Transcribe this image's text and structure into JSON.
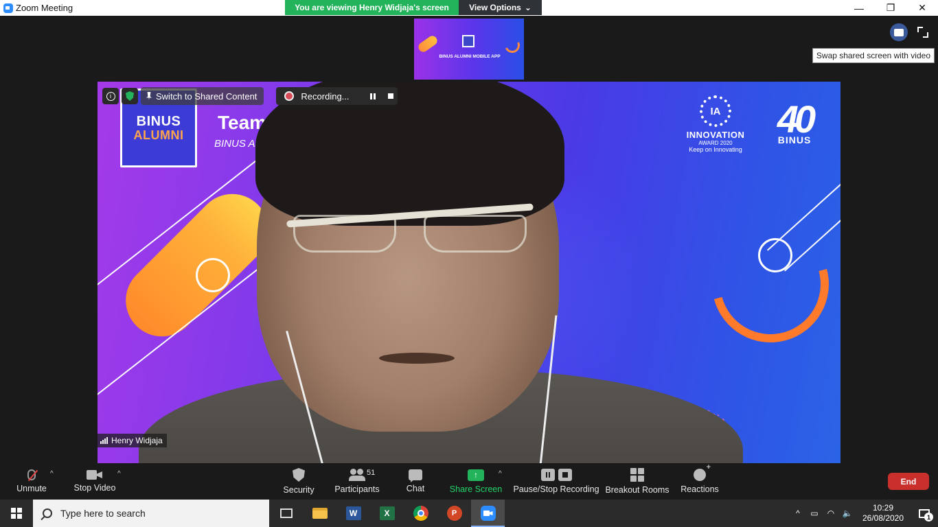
{
  "window": {
    "title": "Zoom Meeting",
    "controls": [
      "—",
      "❐",
      "✕"
    ]
  },
  "banner": {
    "viewing_text": "You are viewing Henry Widjaja's screen",
    "view_options_label": "View Options",
    "viewing_color": "#23b35a"
  },
  "thumbnail": {
    "text": "BINUS ALUMNI MOBILE APP"
  },
  "top_right": {
    "tooltip": "Swap shared screen with video"
  },
  "overlay": {
    "info_symbol": "i",
    "switch_label": "Switch to Shared Content",
    "recording_label": "Recording..."
  },
  "slide": {
    "logo_line1": "BINUS",
    "logo_line2": "ALUMNI",
    "team_title": "Team",
    "team_sub": "BINUS Alum",
    "award_symbol": "IA",
    "award_name": "INNOVATION",
    "award_year": "AWARD 2020",
    "award_tagline": "Keep on Innovating",
    "anniv_number": "40",
    "anniv_brand": "BINUS"
  },
  "participant": {
    "name": "Henry Widjaja"
  },
  "toolbar": {
    "unmute": "Unmute",
    "stop_video": "Stop Video",
    "security": "Security",
    "participants": "Participants",
    "participants_count": "51",
    "chat": "Chat",
    "share_screen": "Share Screen",
    "share_arrow": "↑",
    "pause_stop_recording": "Pause/Stop Recording",
    "breakout_rooms": "Breakout Rooms",
    "reactions": "Reactions",
    "end": "End",
    "caret": "^",
    "end_color": "#c9302c"
  },
  "taskbar": {
    "search_placeholder": "Type here to search",
    "word_letter": "W",
    "excel_letter": "X",
    "ppt_letter": "P",
    "clock_time": "10:29",
    "clock_date": "26/08/2020",
    "tray_chevron": "^",
    "tray_battery": "▭",
    "tray_wifi": "◠",
    "tray_volume": "🔈",
    "notification_count": "1",
    "apps": [
      "task-view",
      "file-explorer",
      "word",
      "excel",
      "chrome",
      "powerpoint",
      "zoom"
    ]
  }
}
